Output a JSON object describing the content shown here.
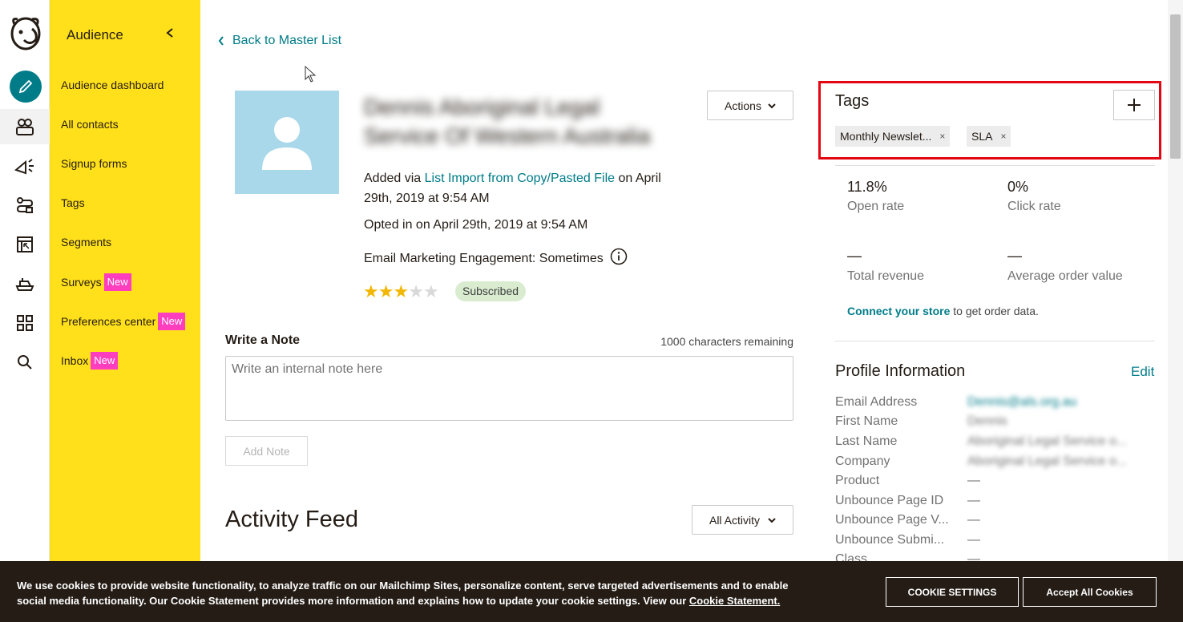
{
  "sidebar": {
    "header": "Audience",
    "items": [
      {
        "label": "Audience dashboard",
        "badge": ""
      },
      {
        "label": "All contacts",
        "badge": ""
      },
      {
        "label": "Signup forms",
        "badge": ""
      },
      {
        "label": "Tags",
        "badge": ""
      },
      {
        "label": "Segments",
        "badge": ""
      },
      {
        "label": "Surveys",
        "badge": "New"
      },
      {
        "label": "Preferences center",
        "badge": "New"
      },
      {
        "label": "Inbox",
        "badge": "New"
      }
    ]
  },
  "rail_icons": [
    "mailchimp-logo-icon",
    "pencil-icon",
    "audience-icon",
    "campaigns-icon",
    "automations-icon",
    "website-icon",
    "integrations-icon",
    "grid-icon",
    "search-icon"
  ],
  "main": {
    "back_link": "Back to Master List",
    "contact_name": "Dennis Aboriginal Legal Service Of Western Australia",
    "actions_label": "Actions",
    "added_prefix": "Added via ",
    "added_source": "List Import from Copy/Pasted File",
    "added_suffix": " on April 29th, 2019 at 9:54 AM",
    "opted_in": "Opted in on April 29th, 2019 at 9:54 AM",
    "engagement": "Email Marketing Engagement: Sometimes",
    "rating": 3,
    "rating_max": 5,
    "status": "Subscribed",
    "note_label": "Write a Note",
    "note_remaining": "1000 characters remaining",
    "note_placeholder": "Write an internal note here",
    "add_note_label": "Add Note",
    "feed_title": "Activity Feed",
    "feed_filter": "All Activity"
  },
  "tags": {
    "title": "Tags",
    "items": [
      "Monthly Newslet...",
      "SLA"
    ],
    "remove_glyph": "×"
  },
  "stats": {
    "open_rate_value": "11.8%",
    "open_rate_label": "Open rate",
    "click_rate_value": "0%",
    "click_rate_label": "Click rate",
    "revenue_value": "—",
    "revenue_label": "Total revenue",
    "aov_value": "—",
    "aov_label": "Average order value",
    "connect_link": "Connect your store",
    "connect_suffix": " to get order data."
  },
  "profile": {
    "title": "Profile Information",
    "edit_label": "Edit",
    "fields": [
      {
        "label": "Email Address",
        "value": "Dennis@als.org.au"
      },
      {
        "label": "First Name",
        "value": "Dennis"
      },
      {
        "label": "Last Name",
        "value": "Aboriginal Legal Service o..."
      },
      {
        "label": "Company",
        "value": "Aboriginal Legal Service o..."
      },
      {
        "label": "Product",
        "value": "—"
      },
      {
        "label": "Unbounce Page ID",
        "value": "—"
      },
      {
        "label": "Unbounce Page V...",
        "value": "—"
      },
      {
        "label": "Unbounce Submi...",
        "value": "—"
      },
      {
        "label": "Class",
        "value": "—"
      }
    ]
  },
  "cookie": {
    "text": "We use cookies to provide website functionality, to analyze traffic on our Mailchimp Sites, personalize content, serve targeted advertisements and to enable social media functionality. Our Cookie Statement provides more information and explains how to update your cookie settings. View our ",
    "link": "Cookie Statement.",
    "settings_label": "COOKIE SETTINGS",
    "accept_label": "Accept All Cookies"
  },
  "colors": {
    "brand_yellow": "#ffe01b",
    "link_teal": "#007c89",
    "new_badge": "#ff3ebf",
    "highlight_red": "#e30613",
    "cookie_bg": "#241c15"
  }
}
